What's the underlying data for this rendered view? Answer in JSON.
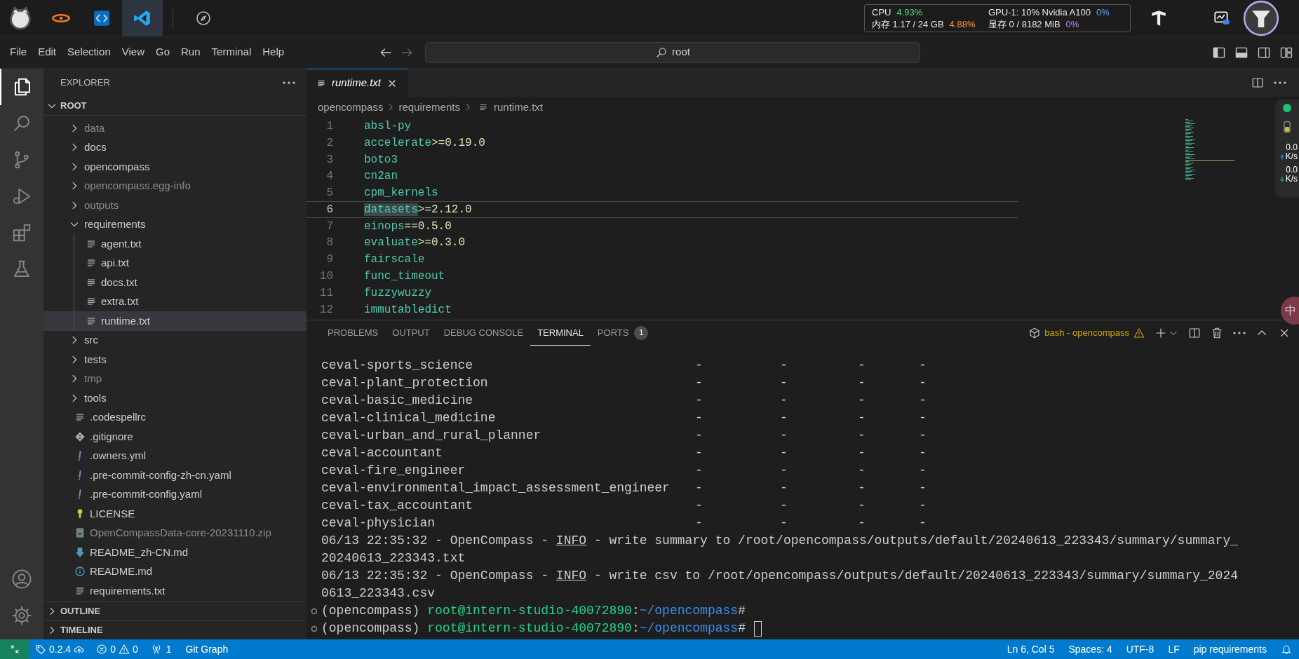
{
  "topbar": {
    "apps": [
      {
        "kind": "mascot",
        "selected": false
      },
      {
        "kind": "orbit",
        "selected": false
      },
      {
        "kind": "code",
        "selected": false
      },
      {
        "kind": "vscode",
        "selected": true
      },
      {
        "kind": "compass",
        "selected": false
      }
    ],
    "monitor": {
      "cpu_label": "CPU",
      "cpu_value": "4.93%",
      "mem_label": "内存 1.17 / 24 GB",
      "mem_value": "4.88%",
      "gpu_label": "GPU-1: 10% Nvidia A100",
      "gpu_value": "0%",
      "vram_label": "显存 0 / 8182 MiB",
      "vram_value": "0%"
    }
  },
  "menu": [
    "File",
    "Edit",
    "Selection",
    "View",
    "Go",
    "Run",
    "Terminal",
    "Help"
  ],
  "command_center": {
    "value": "root"
  },
  "activity_bar": [
    {
      "kind": "explorer",
      "selected": true
    },
    {
      "kind": "search",
      "selected": false
    },
    {
      "kind": "scm",
      "selected": false
    },
    {
      "kind": "debug",
      "selected": false
    },
    {
      "kind": "extensions",
      "selected": false
    },
    {
      "kind": "testing",
      "selected": false
    },
    {
      "kind": "account",
      "selected": false
    },
    {
      "kind": "settings",
      "selected": false
    }
  ],
  "explorer": {
    "title": "EXPLORER",
    "root": {
      "label": "ROOT",
      "expanded": true,
      "children": [
        {
          "label": "data",
          "kind": "folder",
          "expanded": false,
          "dimmed": true,
          "selected": false
        },
        {
          "label": "docs",
          "kind": "folder",
          "expanded": false,
          "dimmed": false,
          "selected": false
        },
        {
          "label": "opencompass",
          "kind": "folder",
          "expanded": false,
          "dimmed": false,
          "selected": false
        },
        {
          "label": "opencompass.egg-info",
          "kind": "folder",
          "expanded": false,
          "dimmed": true,
          "selected": false
        },
        {
          "label": "outputs",
          "kind": "folder",
          "expanded": false,
          "dimmed": true,
          "selected": false
        },
        {
          "label": "requirements",
          "kind": "folder",
          "expanded": true,
          "dimmed": false,
          "selected": false,
          "children": [
            {
              "label": "agent.txt",
              "kind": "text",
              "dimmed": false,
              "selected": false
            },
            {
              "label": "api.txt",
              "kind": "text",
              "dimmed": false,
              "selected": false
            },
            {
              "label": "docs.txt",
              "kind": "text",
              "dimmed": false,
              "selected": false
            },
            {
              "label": "extra.txt",
              "kind": "text",
              "dimmed": false,
              "selected": false
            },
            {
              "label": "runtime.txt",
              "kind": "text",
              "dimmed": false,
              "selected": true
            }
          ]
        },
        {
          "label": "src",
          "kind": "folder",
          "expanded": false,
          "dimmed": false,
          "selected": false
        },
        {
          "label": "tests",
          "kind": "folder",
          "expanded": false,
          "dimmed": false,
          "selected": false
        },
        {
          "label": "tmp",
          "kind": "folder",
          "expanded": false,
          "dimmed": true,
          "selected": false
        },
        {
          "label": "tools",
          "kind": "folder",
          "expanded": false,
          "dimmed": false,
          "selected": false
        },
        {
          "label": ".codespellrc",
          "kind": "text",
          "dimmed": false,
          "selected": false
        },
        {
          "label": ".gitignore",
          "kind": "git",
          "dimmed": false,
          "selected": false
        },
        {
          "label": ".owners.yml",
          "kind": "yaml",
          "dimmed": false,
          "selected": false
        },
        {
          "label": ".pre-commit-config-zh-cn.yaml",
          "kind": "yaml",
          "dimmed": false,
          "selected": false
        },
        {
          "label": ".pre-commit-config.yaml",
          "kind": "yaml",
          "dimmed": false,
          "selected": false
        },
        {
          "label": "LICENSE",
          "kind": "license",
          "dimmed": false,
          "selected": false
        },
        {
          "label": "OpenCompassData-core-20231110.zip",
          "kind": "archive",
          "dimmed": true,
          "selected": false
        },
        {
          "label": "README_zh-CN.md",
          "kind": "markdown",
          "dimmed": false,
          "selected": false
        },
        {
          "label": "README.md",
          "kind": "info",
          "dimmed": false,
          "selected": false
        },
        {
          "label": "requirements.txt",
          "kind": "text",
          "dimmed": false,
          "selected": false
        }
      ]
    },
    "sections": [
      {
        "label": "OUTLINE",
        "expanded": false
      },
      {
        "label": "TIMELINE",
        "expanded": false
      }
    ]
  },
  "editor": {
    "tabs": [
      {
        "label": "runtime.txt",
        "selected": true
      }
    ],
    "breadcrumbs": [
      "opencompass",
      "requirements",
      "runtime.txt"
    ],
    "lines": [
      {
        "number": "1",
        "name": "absl-py",
        "selected": false
      },
      {
        "number": "2",
        "name": "accelerate",
        "spec": ">=0.19.0",
        "selected": false
      },
      {
        "number": "3",
        "name": "boto3",
        "selected": false
      },
      {
        "number": "4",
        "name": "cn2an",
        "selected": false
      },
      {
        "number": "5",
        "name": "cpm_kernels",
        "selected": false
      },
      {
        "number": "6",
        "name": "datasets",
        "spec": ">=2.12.0",
        "selected": true
      },
      {
        "number": "7",
        "name": "einops",
        "spec": "==0.5.0",
        "selected": false
      },
      {
        "number": "8",
        "name": "evaluate",
        "spec": ">=0.3.0",
        "selected": false
      },
      {
        "number": "9",
        "name": "fairscale",
        "selected": false
      },
      {
        "number": "10",
        "name": "func_timeout",
        "selected": false
      },
      {
        "number": "11",
        "name": "fuzzywuzzy",
        "selected": false
      },
      {
        "number": "12",
        "name": "immutabledict",
        "selected": false
      }
    ]
  },
  "network": {
    "up": "0.0",
    "up_unit": "K/s",
    "down": "0.0",
    "down_unit": "K/s"
  },
  "ime": "中",
  "panel": {
    "tabs": [
      {
        "label": "PROBLEMS",
        "selected": false
      },
      {
        "label": "OUTPUT",
        "selected": false
      },
      {
        "label": "DEBUG CONSOLE",
        "selected": false
      },
      {
        "label": "TERMINAL",
        "selected": true
      },
      {
        "label": "PORTS",
        "selected": false,
        "badge": "1"
      }
    ],
    "terminal_name": "bash - opencompass",
    "rows": [
      {
        "name": "ceval-sports_science",
        "cells": [
          "-",
          "-",
          "-",
          "-"
        ]
      },
      {
        "name": "ceval-plant_protection",
        "cells": [
          "-",
          "-",
          "-",
          "-"
        ]
      },
      {
        "name": "ceval-basic_medicine",
        "cells": [
          "-",
          "-",
          "-",
          "-"
        ]
      },
      {
        "name": "ceval-clinical_medicine",
        "cells": [
          "-",
          "-",
          "-",
          "-"
        ]
      },
      {
        "name": "ceval-urban_and_rural_planner",
        "cells": [
          "-",
          "-",
          "-",
          "-"
        ]
      },
      {
        "name": "ceval-accountant",
        "cells": [
          "-",
          "-",
          "-",
          "-"
        ]
      },
      {
        "name": "ceval-fire_engineer",
        "cells": [
          "-",
          "-",
          "-",
          "-"
        ]
      },
      {
        "name": "ceval-environmental_impact_assessment_engineer",
        "cells": [
          "-",
          "-",
          "-",
          "-"
        ]
      },
      {
        "name": "ceval-tax_accountant",
        "cells": [
          "-",
          "-",
          "-",
          "-"
        ]
      },
      {
        "name": "ceval-physician",
        "cells": [
          "-",
          "-",
          "-",
          "-"
        ]
      }
    ],
    "logs": [
      {
        "prefix": "06/13 22:35:32 - OpenCompass - ",
        "level": "INFO",
        "message": " - write summary to /root/opencompass/outputs/default/20240613_223343/summary/summary_20240613_223343.txt"
      },
      {
        "prefix": "06/13 22:35:32 - OpenCompass - ",
        "level": "INFO",
        "message": " - write csv to /root/opencompass/outputs/default/20240613_223343/summary/summary_20240613_223343.csv"
      }
    ],
    "prompts": [
      {
        "env": "(opencompass) ",
        "user": "root@intern-studio-40072890",
        "separator": ":",
        "path": "~/opencompass",
        "symbol": "#",
        "cursor": false
      },
      {
        "env": "(opencompass) ",
        "user": "root@intern-studio-40072890",
        "separator": ":",
        "path": "~/opencompass",
        "symbol": "#",
        "cursor": true
      }
    ]
  },
  "status_bar": {
    "left": [
      {
        "kind": "remote"
      },
      {
        "kind": "version",
        "text": "0.2.4"
      },
      {
        "kind": "problems",
        "errors": "0",
        "warnings": "0"
      },
      {
        "kind": "ports",
        "text": "1"
      },
      {
        "kind": "plain",
        "text": "Git Graph"
      }
    ],
    "right": [
      "Ln 6, Col 5",
      "Spaces: 4",
      "UTF-8",
      "LF",
      "pip requirements"
    ]
  }
}
